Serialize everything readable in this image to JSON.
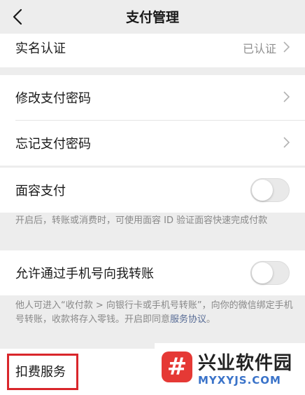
{
  "nav": {
    "back_icon": "chevron-left-icon",
    "title": "支付管理"
  },
  "rows": {
    "realname": {
      "label": "实名认证",
      "value": "已认证"
    },
    "modify_password": {
      "label": "修改支付密码"
    },
    "forgot_password": {
      "label": "忘记支付密码"
    },
    "face_pay": {
      "label": "面容支付",
      "toggle_on": false
    },
    "phone_transfer": {
      "label": "允许通过手机号向我转账",
      "toggle_on": false
    },
    "deduction": {
      "label": "扣费服务"
    }
  },
  "notes": {
    "face_pay": "开启后，转账或消费时，可使用面容 ID 验证面容快速完成付款",
    "phone_transfer_text": "他人可进入“收付款 > 向银行卡或手机号转账”，向你的微信绑定手机号转账，收款将存入零钱。开启即同意",
    "phone_transfer_link": "服务协议",
    "phone_transfer_end": "。"
  },
  "watermark": {
    "name": "兴业软件园",
    "url": "MYXYJS.COM",
    "logo_char": "#"
  },
  "colors": {
    "link": "#576b95",
    "highlight": "#d9262b",
    "background": "#ededed"
  }
}
